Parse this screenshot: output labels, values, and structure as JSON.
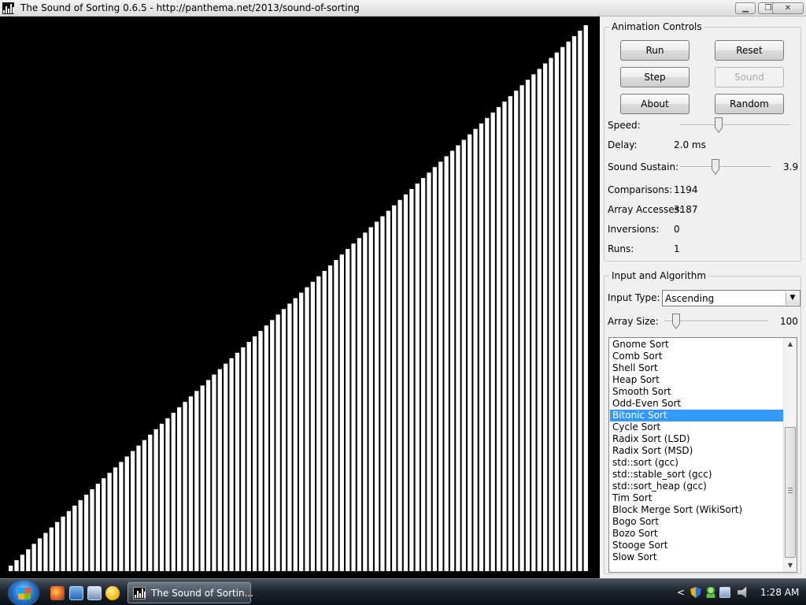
{
  "window": {
    "title": "The Sound of Sorting 0.6.5 - http://panthema.net/2013/sound-of-sorting",
    "minimize_glyph": "▁",
    "maximize_glyph": "❐",
    "close_glyph": "✕"
  },
  "canvas": {
    "bar_count": 100,
    "bar_color": "#ffffff",
    "background_color": "#000000",
    "order": "ascending"
  },
  "animation_controls": {
    "legend": "Animation Controls",
    "run_label": "Run",
    "reset_label": "Reset",
    "step_label": "Step",
    "sound_label": "Sound",
    "about_label": "About",
    "random_label": "Random",
    "speed_label": "Speed:",
    "speed_level": 0.34,
    "delay_label": "Delay:",
    "delay_value": "2.0 ms",
    "sustain_label": "Sound Sustain:",
    "sustain_level": 0.38,
    "sustain_value": "3.9",
    "comparisons_label": "Comparisons:",
    "comparisons_value": "1194",
    "accesses_label": "Array Accesses:",
    "accesses_value": "3187",
    "inversions_label": "Inversions:",
    "inversions_value": "0",
    "runs_label": "Runs:",
    "runs_value": "1"
  },
  "input_algorithm": {
    "legend": "Input and Algorithm",
    "input_type_label": "Input Type:",
    "input_type_value": "Ascending",
    "array_size_label": "Array Size:",
    "array_size_level": 0.08,
    "array_size_value": "100",
    "algorithms": [
      "Gnome Sort",
      "Comb Sort",
      "Shell Sort",
      "Heap Sort",
      "Smooth Sort",
      "Odd-Even Sort",
      "Bitonic Sort",
      "Cycle Sort",
      "Radix Sort (LSD)",
      "Radix Sort (MSD)",
      "std::sort (gcc)",
      "std::stable_sort (gcc)",
      "std::sort_heap (gcc)",
      "Tim Sort",
      "Block Merge Sort (WikiSort)",
      "Bogo Sort",
      "Bozo Sort",
      "Stooge Sort",
      "Slow Sort"
    ],
    "selected_algorithm": "Bitonic Sort",
    "selection_color": "#3399ff"
  },
  "taskbar": {
    "task_label": "The Sound of Sortin...",
    "clock": "1:28 AM",
    "tray_chevron": "<"
  }
}
